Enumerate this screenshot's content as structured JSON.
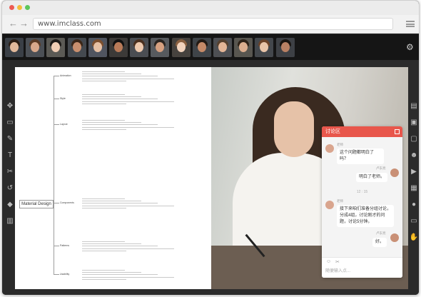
{
  "browser": {
    "url": "www.imclass.com",
    "back_icon": "arrow-left-icon",
    "forward_icon": "arrow-right-icon",
    "menu_icon": "hamburger-menu-icon"
  },
  "participants": {
    "count": 14,
    "settings_icon": "gear-icon"
  },
  "left_toolbar": {
    "tools": [
      "move-icon",
      "folder-icon",
      "pencil-icon",
      "text-icon",
      "cut-icon",
      "undo-icon",
      "eraser-icon",
      "trash-icon"
    ]
  },
  "right_toolbar": {
    "tools": [
      "document-icon",
      "screen-icon",
      "whiteboard-icon",
      "people-icon",
      "video-icon",
      "grid-icon",
      "mic-icon",
      "chat-icon",
      "hand-icon"
    ]
  },
  "slide": {
    "root_label": "Material Design",
    "branches": [
      "Animation",
      "Style",
      "Layout",
      "Components",
      "Patterns",
      "Usability"
    ]
  },
  "chat": {
    "title": "讨论区",
    "messages": [
      {
        "sender": "老师",
        "text": "这个问题都明白了吗？",
        "side": "left"
      },
      {
        "sender": "卢东亮",
        "text": "明白了老师。",
        "side": "right"
      },
      {
        "sender": "老师",
        "text": "接下来咱们准备分组讨论，分成4组，讨论刚才的问题，讨论5分钟。",
        "side": "left"
      },
      {
        "sender": "卢东亮",
        "text": "好。",
        "side": "right"
      }
    ],
    "timestamp": "12 : 15",
    "input_placeholder": "随便输入点...",
    "accent_color": "#e8564b"
  }
}
